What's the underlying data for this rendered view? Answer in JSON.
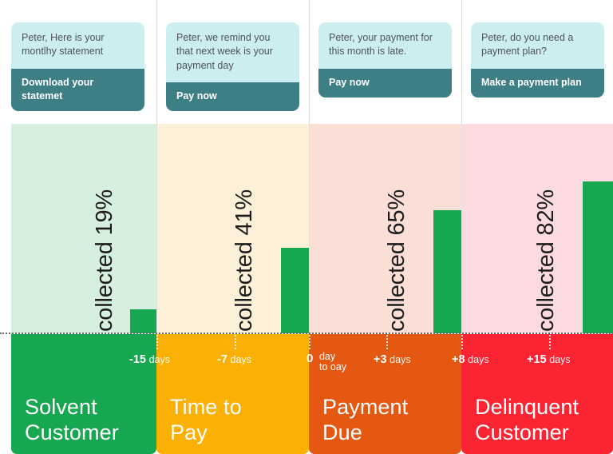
{
  "columns": [
    {
      "key": "solvent",
      "bubble": {
        "message": "Peter, Here is your montlhy statement",
        "cta": "Download your statemet"
      },
      "collected_label": "collected 19%",
      "collected_pct": 19,
      "band_color": "#17a750",
      "plot_tint": "#d7efdf",
      "category": "Solvent\nCustomer"
    },
    {
      "key": "time-to-pay",
      "bubble": {
        "message": "Peter, we remind you that next week is your payment day",
        "cta": "Pay now"
      },
      "collected_label": "collected 41%",
      "collected_pct": 41,
      "band_color": "#fbb005",
      "plot_tint": "#fdf0d8",
      "category": "Time to\nPay"
    },
    {
      "key": "payment-due",
      "bubble": {
        "message": "Peter, your payment for this month is late.",
        "cta": "Pay now"
      },
      "collected_label": "collected 65%",
      "collected_pct": 65,
      "band_color": "#e55812",
      "plot_tint": "#fbdfd6",
      "category": "Payment\nDue"
    },
    {
      "key": "delinquent",
      "bubble": {
        "message": "Peter, do you need a payment plan?",
        "cta": "Make a payment plan"
      },
      "collected_label": "collected 82%",
      "collected_pct": 82,
      "band_color": "#fb2433",
      "plot_tint": "#fcdbe0",
      "category": "Delinquent\nCustomer"
    }
  ],
  "day_marks": [
    {
      "num": "-15",
      "unit": "days",
      "second_line": ""
    },
    {
      "num": "-7",
      "unit": "days",
      "second_line": ""
    },
    {
      "num": "0",
      "unit": "day",
      "second_line": "to oay"
    },
    {
      "num": "+3",
      "unit": "days",
      "second_line": ""
    },
    {
      "num": "+8",
      "unit": "days",
      "second_line": ""
    },
    {
      "num": "+15",
      "unit": "days",
      "second_line": ""
    }
  ],
  "colors": {
    "bar": "#17a750",
    "bubble_body_bg": "#cdeef0",
    "bubble_cta_bg": "#3e7f86",
    "baseline": "#6b6b6b"
  },
  "chart_data": {
    "type": "bar",
    "title": "",
    "xlabel": "",
    "ylabel": "collected %",
    "categories": [
      "Solvent Customer",
      "Time to Pay",
      "Payment Due",
      "Delinquent Customer"
    ],
    "values": [
      19,
      41,
      65,
      82
    ],
    "data_labels": [
      "collected 19%",
      "collected 41%",
      "collected 65%",
      "collected 82%"
    ],
    "ylim": [
      0,
      100
    ],
    "grid": false,
    "legend": "none",
    "axis_annotations": [
      "-15 days",
      "-7 days",
      "0 day to oay",
      "+3 days",
      "+8 days",
      "+15 days"
    ]
  }
}
